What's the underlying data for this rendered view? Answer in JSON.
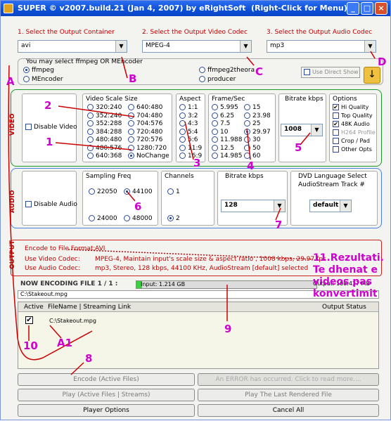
{
  "title": {
    "app": "SUPER © v2007.build.21 (Jan 4, 2007) by eRightSoft",
    "hint": "(Right-Click for Menu)"
  },
  "steps": {
    "container": "1.     Select the Output Container",
    "video_codec": "2.     Select the Output Video Codec",
    "audio_codec": "3.     Select the Output Audio Codec"
  },
  "selects": {
    "container": "avi",
    "video_codec": "MPEG-4",
    "audio_codec": "mp3"
  },
  "encoder": {
    "hint": "You may select ffmpeg OR MEncoder",
    "options": [
      "ffmpeg",
      "MEncoder",
      "ffmpeg2theora",
      "producer"
    ],
    "direct_show": "Use Direct Show"
  },
  "video": {
    "section": "VIDEO",
    "disable": "Disable Video",
    "scale": {
      "label": "Video Scale Size",
      "col1": [
        "320:240",
        "352:240",
        "352:288",
        "384:288",
        "480:480",
        "480:576",
        "640:368"
      ],
      "col2": [
        "640:480",
        "704:480",
        "704:576",
        "720:480",
        "720:576",
        "1280:720",
        "NoChange"
      ]
    },
    "aspect": {
      "label": "Aspect",
      "items": [
        "1:1",
        "3:2",
        "4:3",
        "5:4",
        "5:6",
        "11:9",
        "16:9"
      ]
    },
    "fps": {
      "label": "Frame/Sec",
      "col1": [
        "5.995",
        "6.25",
        "7.5",
        "10",
        "11.988",
        "12.5",
        "14.985"
      ],
      "col2": [
        "15",
        "23.98",
        "25",
        "29.97",
        "30",
        "50",
        "60"
      ]
    },
    "bitrate": {
      "label": "Bitrate  kbps",
      "value": "1008"
    },
    "options": {
      "label": "Options",
      "items": [
        "Hi Quality",
        "Top Quality",
        "48K Audio",
        "H264 Profile",
        "Crop / Pad",
        "Other Opts"
      ]
    }
  },
  "audio": {
    "section": "AUDIO",
    "disable": "Disable Audio",
    "sampling": {
      "label": "Sampling Freq",
      "items": [
        "22050",
        "44100",
        "24000",
        "48000"
      ]
    },
    "channels": {
      "label": "Channels",
      "items": [
        "1",
        "2"
      ]
    },
    "bitrate": {
      "label": "Bitrate  kbps",
      "value": "128"
    },
    "dvd": {
      "label1": "DVD Language Select",
      "label2": "AudioStream  Track #",
      "value": "default"
    }
  },
  "output": {
    "section": "OUTPUT",
    "format_label": "Encode to File Format:",
    "format_value": "AVI",
    "video_label": "Use Video Codec:",
    "video_value": "MPEG-4,  Maintain input's scale size & aspect ratio ,  1008 kbps,  29.97 fps",
    "audio_label": "Use Audio Codec:",
    "audio_value": "mp3,  Stereo,  128 kbps,  44100 KHz,  AudioStream [default] selected"
  },
  "progress": {
    "status": "NOW ENCODING FILE 1 / 1 :",
    "input": "Input: 1.214 GB",
    "output": "Output: 108.437 MB",
    "file": "C:\\Stakeout.mpg",
    "fill": 0.03
  },
  "list": {
    "headers": [
      "Active",
      "FileName  |  Streaming Link",
      "Output Status"
    ],
    "row_file": "C:\\Stakeout.mpg"
  },
  "buttons": {
    "encode": "Encode (Active Files)",
    "error": "An ERROR has occurred. Click to read more....",
    "play_active": "Play (Active Files | Streams)",
    "play_last": "Play The Last Rendered File",
    "player_options": "Player Options",
    "cancel_all": "Cancel All"
  },
  "annotations": {
    "a": "A",
    "b": "B",
    "c": "C",
    "d": "D",
    "n1": "1",
    "n2": "2",
    "n3": "3",
    "n4": "4",
    "n5": "5",
    "n6": "6",
    "n7": "7",
    "n8": "8",
    "n9": "9",
    "n10": "10",
    "a1": "A1",
    "result": "11.Rezultati.\nTe dhenat e\nvideos pas\nkonvertimit"
  },
  "colors": {
    "title_bar": "#0b4fd8",
    "annotation": "#d000d0",
    "video_border": "#1a9a2a",
    "audio_border": "#4a7fe0",
    "output_border": "#cc2222"
  }
}
